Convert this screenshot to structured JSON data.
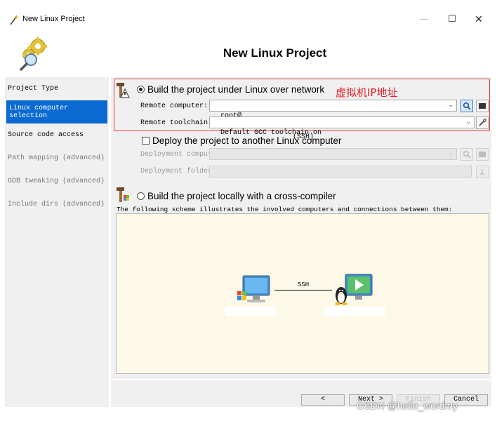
{
  "window": {
    "title": "New Linux Project",
    "minimize_glyph": "—",
    "maximize_glyph": "☐",
    "close_glyph": "✕"
  },
  "header": {
    "title": "New Linux Project"
  },
  "steps": [
    {
      "label": "Project Type",
      "state": "normal"
    },
    {
      "label": "Linux computer selection",
      "state": "active"
    },
    {
      "label": "Source code access",
      "state": "normal"
    },
    {
      "label": "Path mapping (advanced)",
      "state": "disabled"
    },
    {
      "label": "GDB tweaking (advanced)",
      "state": "disabled"
    },
    {
      "label": "Include dirs (advanced)",
      "state": "disabled"
    }
  ],
  "network_option": {
    "label": "Build the project under Linux over network",
    "selected": true,
    "annotation": "虚拟机IP地址",
    "remote_computer_label": "Remote computer:",
    "remote_computer_value": "root@",
    "remote_computer_protocol": "(SSH)",
    "remote_toolchain_label": "Remote toolchain:",
    "remote_toolchain_value": "Default GCC toolchain on"
  },
  "deploy_option": {
    "label": "Deploy the project to another Linux computer",
    "checked": false,
    "deployment_computer_label": "Deployment computer:",
    "deployment_folder_label": "Deployment folder:"
  },
  "cross_option": {
    "label": "Build the project locally with a cross-compiler",
    "selected": false
  },
  "scheme": {
    "caption": "The following scheme illustrates the involved computers and connections between them:",
    "connection_label": "SSH"
  },
  "navigation": {
    "back_label": "<",
    "next_label": "Next >",
    "finish_label": "Finish",
    "cancel_label": "Cancel"
  },
  "watermark": "CSDN @hello_wordmy",
  "colors": {
    "accent": "#0a6ad1",
    "annotation_red": "#e8212a",
    "diagram_background": "#fcf9e8"
  }
}
